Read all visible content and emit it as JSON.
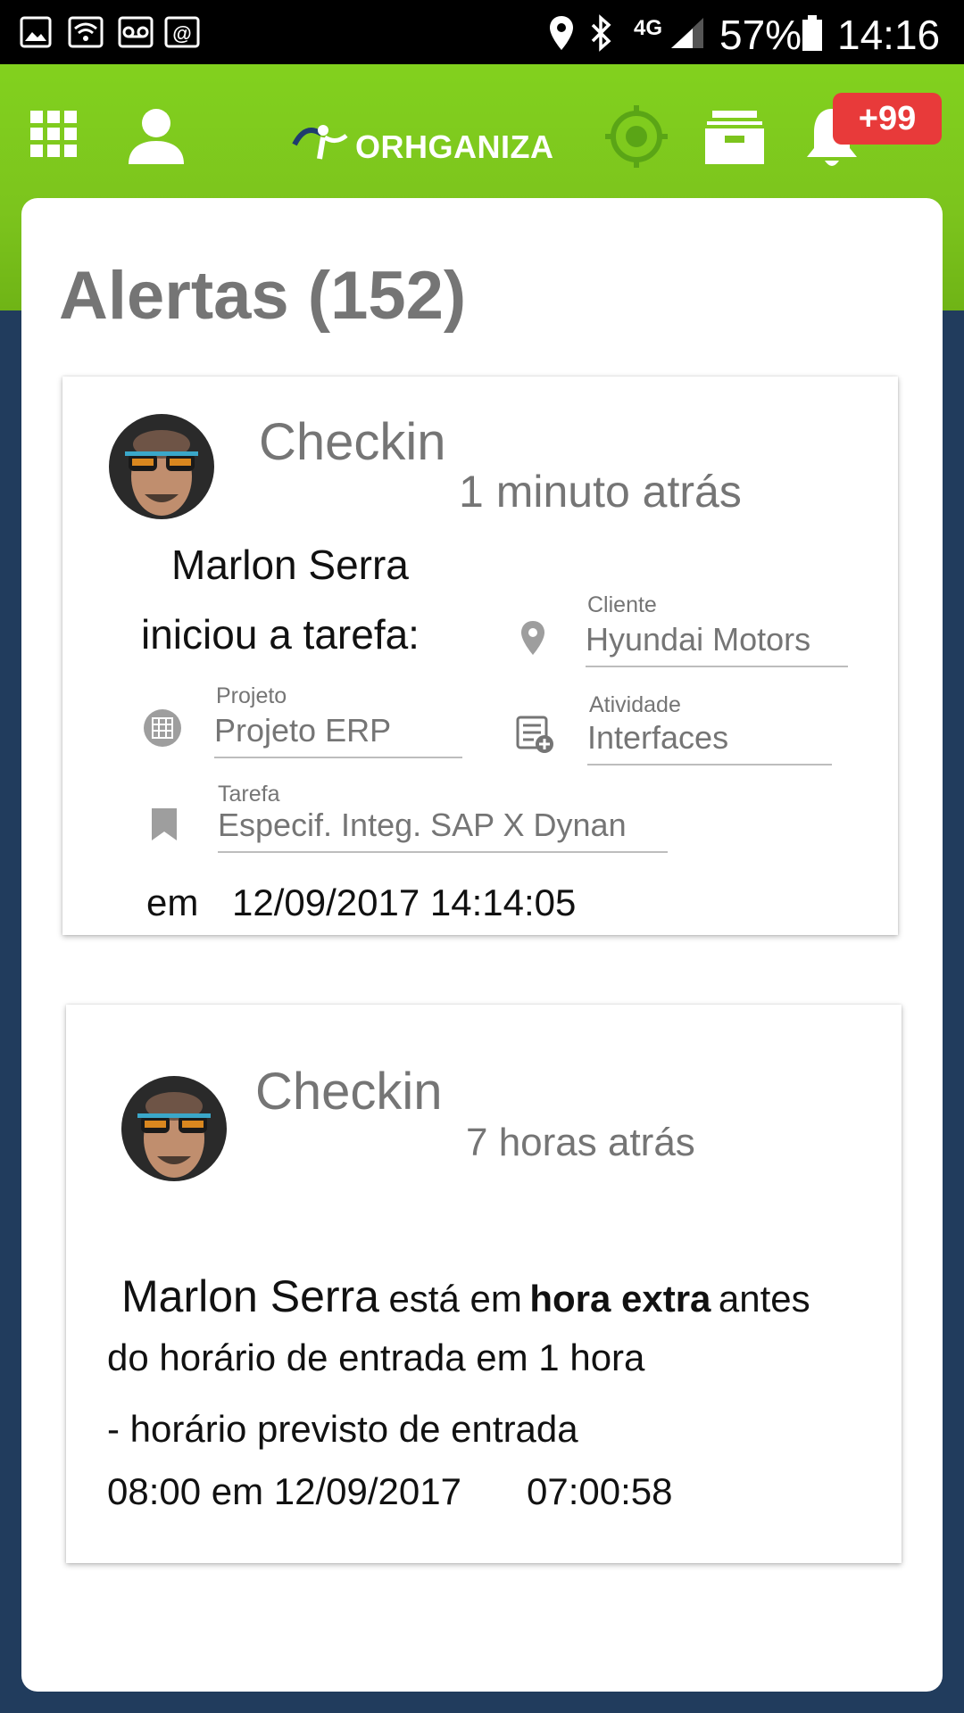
{
  "status_bar": {
    "network": "4G",
    "battery": "57%",
    "time": "14:16"
  },
  "header": {
    "logo_text": "ORHGANIZA",
    "notification_badge": "+99",
    "icons": [
      "apps-grid-icon",
      "person-icon",
      "target-icon",
      "inbox-icon",
      "bell-icon"
    ]
  },
  "page": {
    "title": "Alertas (152)"
  },
  "alerts": [
    {
      "type": "Checkin",
      "time_ago": "1 minuto atrás",
      "user_name": "Marlon Serra",
      "action": "iniciou a tarefa:",
      "fields": {
        "cliente": {
          "label": "Cliente",
          "value": "Hyundai Motors"
        },
        "projeto": {
          "label": "Projeto",
          "value": "Projeto ERP"
        },
        "atividade": {
          "label": "Atividade",
          "value": "Interfaces"
        },
        "tarefa": {
          "label": "Tarefa",
          "value": "Especif. Integ. SAP X Dynan"
        }
      },
      "em_label": "em",
      "datetime": "12/09/2017 14:14:05"
    },
    {
      "type": "Checkin",
      "time_ago": "7 horas atrás",
      "user_name": "Marlon Serra",
      "msg_pre": "está em",
      "msg_bold": "hora extra",
      "msg_post": "antes",
      "line2": "do horário de entrada em 1 hora",
      "line3": "- horário previsto de entrada",
      "line4a": "08:00 em 12/09/2017",
      "line4b": "07:00:58"
    }
  ],
  "colors": {
    "header_green": "#7cc41d",
    "background_navy": "#213c5d",
    "badge_red": "#e83a3a",
    "target_green": "#5aa516"
  }
}
